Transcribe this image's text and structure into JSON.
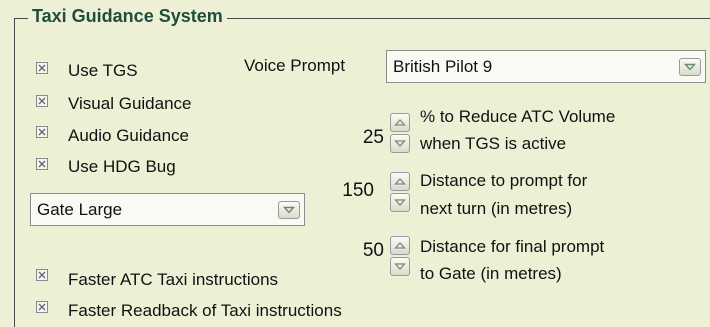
{
  "group": {
    "title": "Taxi Guidance System"
  },
  "checkboxes": {
    "use_tgs": {
      "label": "Use TGS",
      "checked": true
    },
    "visual_guidance": {
      "label": "Visual Guidance",
      "checked": true
    },
    "audio_guidance": {
      "label": "Audio Guidance",
      "checked": true
    },
    "use_hdg_bug": {
      "label": "Use HDG Bug",
      "checked": true
    },
    "faster_atc": {
      "label": "Faster ATC Taxi instructions",
      "checked": true
    },
    "faster_readback": {
      "label": "Faster Readback of Taxi instructions",
      "checked": true
    }
  },
  "voice_prompt": {
    "label": "Voice Prompt",
    "value": "British Pilot 9"
  },
  "gate_select": {
    "value": "Gate Large"
  },
  "spinners": {
    "atc_volume": {
      "value": "25",
      "line1": "% to Reduce ATC Volume",
      "line2": "when TGS is active"
    },
    "next_turn": {
      "value": "150",
      "line1": "Distance to prompt for",
      "line2": "next turn (in metres)"
    },
    "final_prompt": {
      "value": "50",
      "line1": "Distance for final prompt",
      "line2": "to Gate (in metres)"
    }
  },
  "icons": {
    "checkbox_mark": "x-mark-icon",
    "dropdown": "chevron-down-icon",
    "spin_up": "arrow-up-icon",
    "spin_down": "arrow-down-icon"
  },
  "colors": {
    "background": "#eef0d6",
    "title": "#1f4e3d",
    "frame": "#4a4a4a"
  }
}
